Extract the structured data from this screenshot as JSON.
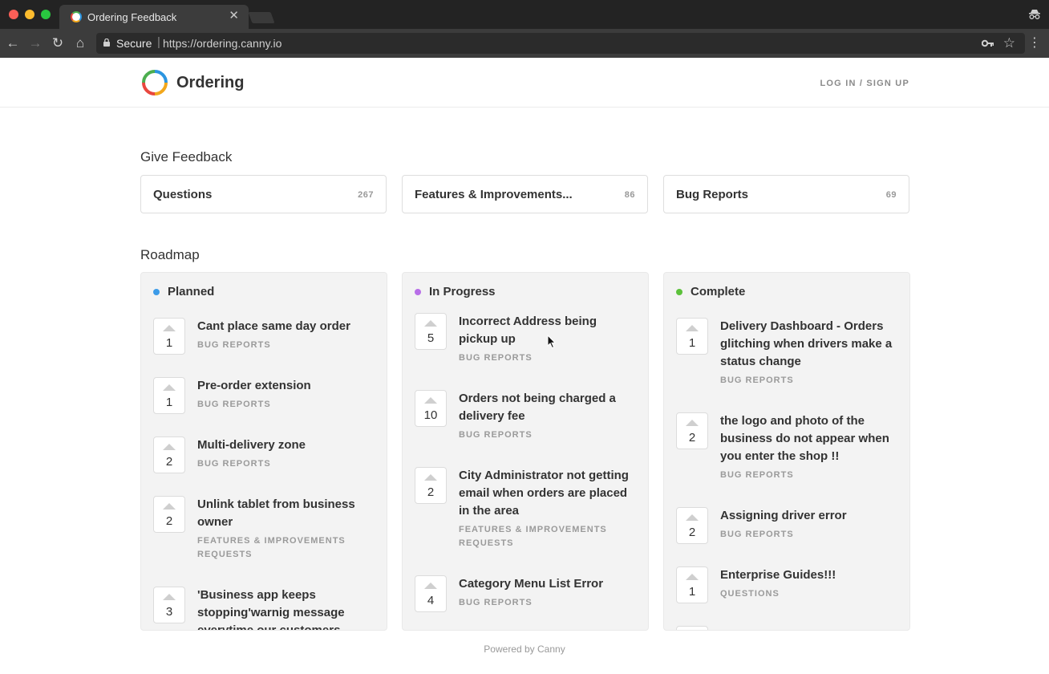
{
  "browser": {
    "tab_title": "Ordering Feedback",
    "tab_close": "✕",
    "secure_label": "Secure",
    "url_separator": "|",
    "url": "https://ordering.canny.io",
    "nav": {
      "back": "←",
      "forward": "→",
      "reload": "↻",
      "home": "⌂",
      "star": "☆",
      "menu": "⋮"
    }
  },
  "header": {
    "company_name": "Ordering",
    "login_label": "LOG IN / SIGN UP"
  },
  "give_feedback": {
    "title": "Give Feedback",
    "boards": [
      {
        "name": "Questions",
        "count": "267"
      },
      {
        "name": "Features & Improvements...",
        "count": "86"
      },
      {
        "name": "Bug Reports",
        "count": "69"
      }
    ]
  },
  "roadmap": {
    "title": "Roadmap",
    "columns": [
      {
        "title": "Planned",
        "dot_color": "#3c9be8",
        "posts": [
          {
            "votes": "1",
            "title": "Cant place same day order",
            "board": "BUG REPORTS"
          },
          {
            "votes": "1",
            "title": "Pre-order extension",
            "board": "BUG REPORTS"
          },
          {
            "votes": "2",
            "title": "Multi-delivery zone",
            "board": "BUG REPORTS"
          },
          {
            "votes": "2",
            "title": "Unlink tablet from business owner",
            "board": "FEATURES & IMPROVEMENTS REQUESTS"
          },
          {
            "votes": "3",
            "title": "'Business app keeps stopping'warnig message everytime our customers",
            "board": ""
          }
        ]
      },
      {
        "title": "In Progress",
        "dot_color": "#b86ee8",
        "posts": [
          {
            "votes": "5",
            "title": "Incorrect Address being pickup up",
            "board": "BUG REPORTS"
          },
          {
            "votes": "10",
            "title": "Orders not being charged a delivery fee",
            "board": "BUG REPORTS"
          },
          {
            "votes": "2",
            "title": "City Administrator not getting email when orders are placed in the area",
            "board": "FEATURES & IMPROVEMENTS REQUESTS"
          },
          {
            "votes": "4",
            "title": "Category Menu List Error",
            "board": "BUG REPORTS"
          }
        ]
      },
      {
        "title": "Complete",
        "dot_color": "#5cc13b",
        "posts": [
          {
            "votes": "1",
            "title": "Delivery Dashboard - Orders glitching when drivers make a status change",
            "board": "BUG REPORTS"
          },
          {
            "votes": "2",
            "title": "the logo and photo of the business do not appear when you enter the shop !!",
            "board": "BUG REPORTS"
          },
          {
            "votes": "2",
            "title": "Assigning driver error",
            "board": "BUG REPORTS"
          },
          {
            "votes": "1",
            "title": "Enterprise Guides!!!",
            "board": "QUESTIONS"
          }
        ]
      }
    ]
  },
  "footer": {
    "powered_by": "Powered by Canny"
  }
}
